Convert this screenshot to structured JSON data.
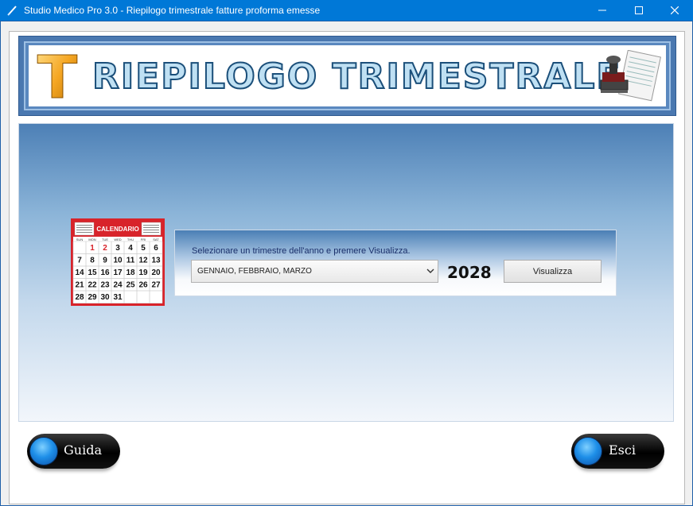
{
  "window": {
    "title": "Studio Medico Pro 3.0 - Riepilogo trimestrale fatture proforma emesse",
    "icon": "pen-icon",
    "controls": [
      "minimize-icon",
      "maximize-icon",
      "close-icon"
    ]
  },
  "banner": {
    "logo_letter": "T",
    "title": "RIEPILOGO TRIMESTRALE",
    "icon": "stamp-and-invoices-icon"
  },
  "calendar": {
    "title": "CALENDARIO",
    "weekdays": [
      "SUN",
      "MON",
      "TUE",
      "WED",
      "THU",
      "FRI",
      "SAT"
    ],
    "rows": [
      [
        "",
        "1",
        "2",
        "3",
        "4",
        "5",
        "6"
      ],
      [
        "7",
        "8",
        "9",
        "10",
        "11",
        "12",
        "13"
      ],
      [
        "14",
        "15",
        "16",
        "17",
        "18",
        "19",
        "20"
      ],
      [
        "21",
        "22",
        "23",
        "24",
        "25",
        "26",
        "27"
      ],
      [
        "28",
        "29",
        "30",
        "31",
        "",
        "",
        ""
      ]
    ],
    "accent_color": "#d8232a"
  },
  "form": {
    "prompt": "Selezionare un trimestre dell'anno e premere Visualizza.",
    "quarter_value": "GENNAIO, FEBBRAIO, MARZO",
    "year": "2028",
    "view_button": "Visualizza"
  },
  "footer": {
    "help_button": "Guida",
    "exit_button": "Esci"
  },
  "colors": {
    "titlebar": "#0078d7",
    "header_frame": "#4a78b0",
    "banner_text": "#bfe0f3",
    "banner_stroke": "#1b4f7a",
    "logo": "#f5a623",
    "orb": "#1e8fe8"
  }
}
